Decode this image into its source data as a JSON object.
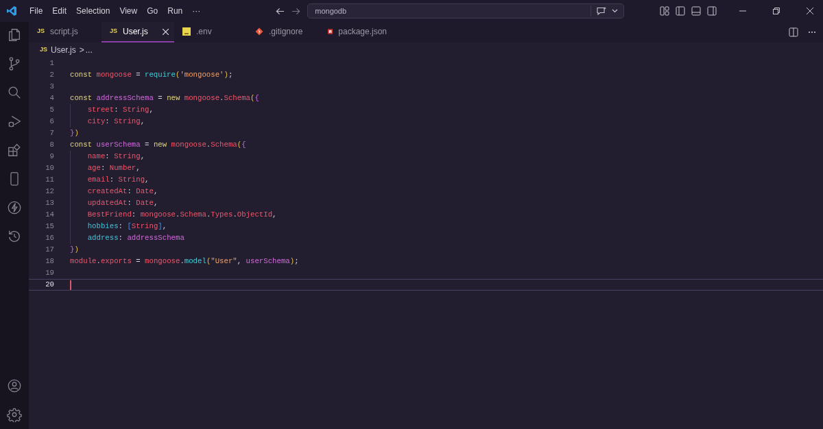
{
  "menu": [
    "File",
    "Edit",
    "Selection",
    "View",
    "Go",
    "Run",
    "···"
  ],
  "search": {
    "value": "mongodb"
  },
  "tabs": [
    {
      "label": "script.js",
      "kind": "js",
      "icon_text": "JS",
      "selected": false
    },
    {
      "label": "User.js",
      "kind": "js",
      "icon_text": "JS",
      "selected": true
    },
    {
      "label": ".env",
      "kind": "env",
      "selected": false
    },
    {
      "label": ".gitignore",
      "kind": "git",
      "selected": false
    },
    {
      "label": "package.json",
      "kind": "npm",
      "selected": false
    }
  ],
  "breadcrumb": {
    "icon_text": "JS",
    "file": "User.js",
    "separator": ">",
    "rest": "..."
  },
  "lines": [
    {
      "n": "1"
    },
    {
      "n": "2",
      "tokens": [
        {
          "t": "const ",
          "kind": "keyword"
        },
        {
          "t": "mongoose",
          "kind": "variable"
        },
        {
          "t": " = ",
          "kind": "plain"
        },
        {
          "t": "require",
          "kind": "function"
        },
        {
          "t": "(",
          "kind": "paren"
        },
        {
          "t": "'mongoose'",
          "kind": "string"
        },
        {
          "t": ")",
          "kind": "paren"
        },
        {
          "t": ";",
          "kind": "plain"
        }
      ]
    },
    {
      "n": "3"
    },
    {
      "n": "4",
      "tokens": [
        {
          "t": "const ",
          "kind": "keyword"
        },
        {
          "t": "addressSchema",
          "kind": "constant"
        },
        {
          "t": " = ",
          "kind": "plain"
        },
        {
          "t": "new ",
          "kind": "keyword"
        },
        {
          "t": "mongoose",
          "kind": "variable"
        },
        {
          "t": ".",
          "kind": "plain"
        },
        {
          "t": "Schema",
          "kind": "variable"
        },
        {
          "t": "(",
          "kind": "paren"
        },
        {
          "t": "{",
          "kind": "brace"
        }
      ]
    },
    {
      "n": "5",
      "indent": true,
      "tokens": [
        {
          "t": "street",
          "kind": "variable"
        },
        {
          "t": ": ",
          "kind": "plain"
        },
        {
          "t": "String",
          "kind": "variable"
        },
        {
          "t": ",",
          "kind": "plain"
        }
      ]
    },
    {
      "n": "6",
      "indent": true,
      "tokens": [
        {
          "t": "city",
          "kind": "variable"
        },
        {
          "t": ": ",
          "kind": "plain"
        },
        {
          "t": "String",
          "kind": "variable"
        },
        {
          "t": ",",
          "kind": "plain"
        }
      ]
    },
    {
      "n": "7",
      "tokens": [
        {
          "t": "}",
          "kind": "brace"
        },
        {
          "t": ")",
          "kind": "paren"
        }
      ]
    },
    {
      "n": "8",
      "tokens": [
        {
          "t": "const ",
          "kind": "keyword"
        },
        {
          "t": "userSchema",
          "kind": "constant"
        },
        {
          "t": " = ",
          "kind": "plain"
        },
        {
          "t": "new ",
          "kind": "keyword"
        },
        {
          "t": "mongoose",
          "kind": "variable"
        },
        {
          "t": ".",
          "kind": "plain"
        },
        {
          "t": "Schema",
          "kind": "variable"
        },
        {
          "t": "(",
          "kind": "paren"
        },
        {
          "t": "{",
          "kind": "brace"
        }
      ]
    },
    {
      "n": "9",
      "indent": true,
      "tokens": [
        {
          "t": "name",
          "kind": "variable"
        },
        {
          "t": ": ",
          "kind": "plain"
        },
        {
          "t": "String",
          "kind": "variable"
        },
        {
          "t": ",",
          "kind": "plain"
        }
      ]
    },
    {
      "n": "10",
      "indent": true,
      "tokens": [
        {
          "t": "age",
          "kind": "variable"
        },
        {
          "t": ": ",
          "kind": "plain"
        },
        {
          "t": "Number",
          "kind": "variable"
        },
        {
          "t": ",",
          "kind": "plain"
        }
      ]
    },
    {
      "n": "11",
      "indent": true,
      "tokens": [
        {
          "t": "email",
          "kind": "variable"
        },
        {
          "t": ": ",
          "kind": "plain"
        },
        {
          "t": "String",
          "kind": "variable"
        },
        {
          "t": ",",
          "kind": "plain"
        }
      ]
    },
    {
      "n": "12",
      "indent": true,
      "tokens": [
        {
          "t": "createdAt",
          "kind": "variable"
        },
        {
          "t": ": ",
          "kind": "plain"
        },
        {
          "t": "Date",
          "kind": "variable"
        },
        {
          "t": ",",
          "kind": "plain"
        }
      ]
    },
    {
      "n": "13",
      "indent": true,
      "tokens": [
        {
          "t": "updatedAt",
          "kind": "variable"
        },
        {
          "t": ": ",
          "kind": "plain"
        },
        {
          "t": "Date",
          "kind": "variable"
        },
        {
          "t": ",",
          "kind": "plain"
        }
      ]
    },
    {
      "n": "14",
      "indent": true,
      "tokens": [
        {
          "t": "BestFriend",
          "kind": "variable"
        },
        {
          "t": ": ",
          "kind": "plain"
        },
        {
          "t": "mongoose",
          "kind": "variable"
        },
        {
          "t": ".",
          "kind": "plain"
        },
        {
          "t": "Schema",
          "kind": "variable"
        },
        {
          "t": ".",
          "kind": "plain"
        },
        {
          "t": "Types",
          "kind": "variable"
        },
        {
          "t": ".",
          "kind": "plain"
        },
        {
          "t": "ObjectId",
          "kind": "variable"
        },
        {
          "t": ",",
          "kind": "plain"
        }
      ]
    },
    {
      "n": "15",
      "indent": true,
      "tokens": [
        {
          "t": "hobbies",
          "kind": "property"
        },
        {
          "t": ": ",
          "kind": "plain"
        },
        {
          "t": "[",
          "kind": "bracket"
        },
        {
          "t": "String",
          "kind": "variable"
        },
        {
          "t": "]",
          "kind": "bracket"
        },
        {
          "t": ",",
          "kind": "plain"
        }
      ]
    },
    {
      "n": "16",
      "indent": true,
      "tokens": [
        {
          "t": "address",
          "kind": "property"
        },
        {
          "t": ": ",
          "kind": "plain"
        },
        {
          "t": "addressSchema",
          "kind": "constant"
        }
      ]
    },
    {
      "n": "17",
      "tokens": [
        {
          "t": "}",
          "kind": "brace"
        },
        {
          "t": ")",
          "kind": "paren"
        }
      ]
    },
    {
      "n": "18",
      "tokens": [
        {
          "t": "module",
          "kind": "variable"
        },
        {
          "t": ".",
          "kind": "plain"
        },
        {
          "t": "exports",
          "kind": "variable"
        },
        {
          "t": " = ",
          "kind": "plain"
        },
        {
          "t": "mongoose",
          "kind": "variable"
        },
        {
          "t": ".",
          "kind": "plain"
        },
        {
          "t": "model",
          "kind": "function"
        },
        {
          "t": "(",
          "kind": "paren"
        },
        {
          "t": "\"User\"",
          "kind": "string"
        },
        {
          "t": ", ",
          "kind": "plain"
        },
        {
          "t": "userSchema",
          "kind": "constant"
        },
        {
          "t": ")",
          "kind": "paren"
        },
        {
          "t": ";",
          "kind": "plain"
        }
      ]
    },
    {
      "n": "19"
    },
    {
      "n": "20",
      "current": true
    }
  ]
}
